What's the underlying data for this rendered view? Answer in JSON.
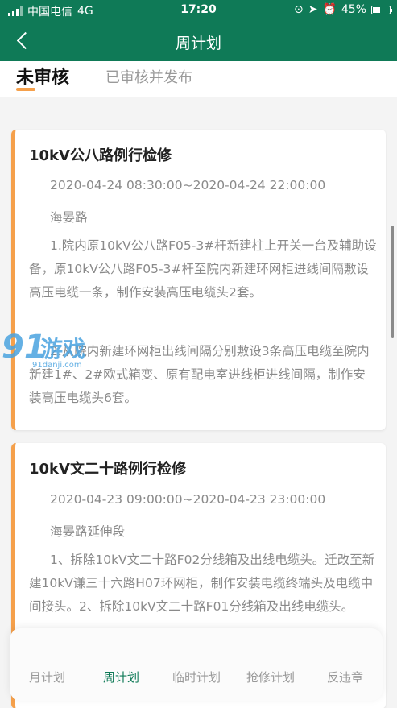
{
  "status_bar": {
    "carrier": "中国电信",
    "network": "4G",
    "time": "17:20",
    "battery_percent": "45%",
    "battery_level": 0.45
  },
  "header": {
    "title": "周计划"
  },
  "tabs": [
    {
      "label": "未审核",
      "active": true
    },
    {
      "label": "已审核并发布",
      "active": false
    }
  ],
  "cards": [
    {
      "title": "10kV公八路例行检修",
      "time": "2020-04-24 08:30:00~2020-04-24 22:00:00",
      "location": "海晏路",
      "desc": [
        "1.院内原10kV公八路F05-3#杆新建柱上开关一台及辅助设备，原10kV公八路F05-3#杆至院内新建环网柜进线间隔敷设高压电缆一条，制作安装高压电缆头2套。",
        "2.从院内新建环网柜出线间隔分别敷设3条高压电缆至院内新建1#、2#欧式箱变、原有配电室进线柜进线间隔，制作安装高压电缆头6套。"
      ]
    },
    {
      "title": "10kV文二十路例行检修",
      "time": "2020-04-23 09:00:00~2020-04-23 23:00:00",
      "location": "海晏路延伸段",
      "desc": [
        "1、拆除10kV文二十路F02分线箱及出线电缆头。迁改至新建10kV谦三十六路H07环网柜，制作安装电缆终端头及电缆中间接头。2、拆除10kV文二十路F01分线箱及出线电缆头。"
      ]
    }
  ],
  "bottom_nav": [
    {
      "label": "月计划",
      "active": false
    },
    {
      "label": "周计划",
      "active": true
    },
    {
      "label": "临时计划",
      "active": false
    },
    {
      "label": "抢修计划",
      "active": false
    },
    {
      "label": "反违章",
      "active": false
    }
  ],
  "watermark": {
    "number": "91",
    "text": "游戏",
    "site": "91danji.com"
  },
  "colors": {
    "primary": "#0f7a57",
    "accent": "#f5a04b",
    "muted_text": "#8a8a8a"
  }
}
